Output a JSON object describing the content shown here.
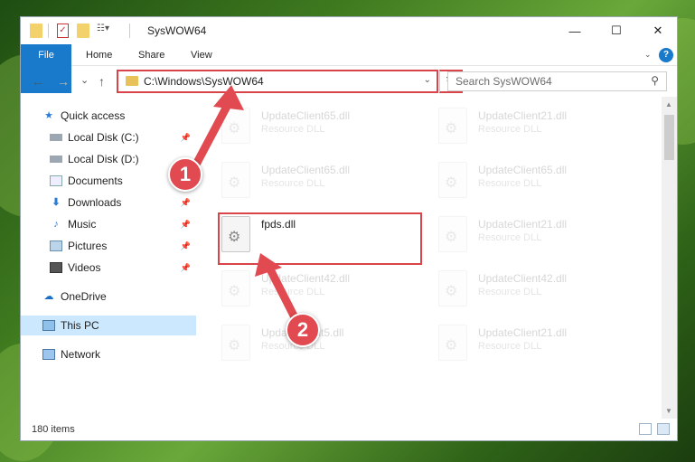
{
  "window": {
    "title": "SysWOW64",
    "controls": {
      "minimize": "—",
      "maximize": "☐",
      "close": "✕"
    }
  },
  "ribbon": {
    "tabs": [
      "File",
      "Home",
      "Share",
      "View"
    ],
    "help": "?"
  },
  "navigation": {
    "back": "←",
    "forward": "→",
    "recent": "⌄",
    "up": "↑",
    "address": "C:\\Windows\\SysWOW64",
    "refresh": "↻",
    "search_placeholder": "Search SysWOW64"
  },
  "sidebar": {
    "items": [
      {
        "label": "Quick access",
        "icon": "star-icon",
        "pinned": false
      },
      {
        "label": "Local Disk (C:)",
        "icon": "drive-icon",
        "pinned": true
      },
      {
        "label": "Local Disk (D:)",
        "icon": "drive-icon",
        "pinned": false
      },
      {
        "label": "Documents",
        "icon": "documents-icon",
        "pinned": true
      },
      {
        "label": "Downloads",
        "icon": "download-icon",
        "pinned": true
      },
      {
        "label": "Music",
        "icon": "music-icon",
        "pinned": true
      },
      {
        "label": "Pictures",
        "icon": "pictures-icon",
        "pinned": true
      },
      {
        "label": "Videos",
        "icon": "videos-icon",
        "pinned": true
      },
      {
        "label": "OneDrive",
        "icon": "cloud-icon",
        "pinned": false
      },
      {
        "label": "This PC",
        "icon": "computer-icon",
        "pinned": false,
        "selected": true
      },
      {
        "label": "Network",
        "icon": "network-icon",
        "pinned": false
      }
    ]
  },
  "files": [
    {
      "name": "UpdateClient65.dll",
      "type": "Resource DLL",
      "faded": true
    },
    {
      "name": "UpdateClient21.dll",
      "type": "Resource DLL",
      "faded": true
    },
    {
      "name": "UpdateClient65.dll",
      "type": "Resource DLL",
      "faded": true
    },
    {
      "name": "UpdateClient65.dll",
      "type": "Resource DLL",
      "faded": true
    },
    {
      "name": "fpds.dll",
      "type": "",
      "faded": false
    },
    {
      "name": "UpdateClient21.dll",
      "type": "Resource DLL",
      "faded": true
    },
    {
      "name": "UpdateClient42.dll",
      "type": "Resource DLL",
      "faded": true
    },
    {
      "name": "UpdateClient42.dll",
      "type": "Resource DLL",
      "faded": true
    },
    {
      "name": "UpdateClient5.dll",
      "type": "Resource DLL",
      "faded": true
    },
    {
      "name": "UpdateClient21.dll",
      "type": "Resource DLL",
      "faded": true
    }
  ],
  "status": {
    "item_count": "180 items"
  },
  "callouts": [
    "1",
    "2"
  ],
  "colors": {
    "accent": "#1979ca",
    "highlight": "#d9434a",
    "selected": "#cce8ff"
  }
}
